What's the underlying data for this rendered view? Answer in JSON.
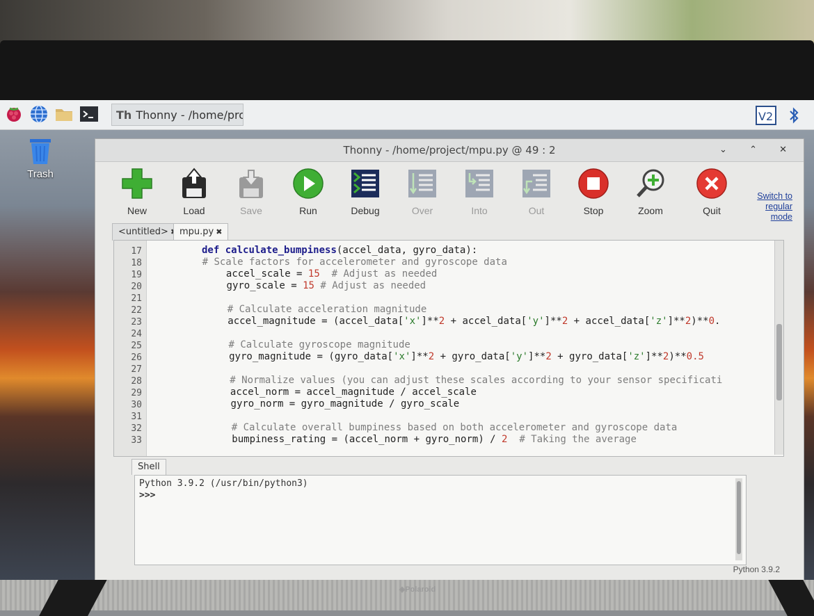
{
  "taskbar": {
    "task_label": "Thonny  -  /home/pro...",
    "right_icons": [
      "vnc-icon",
      "bluetooth-icon"
    ]
  },
  "desktop": {
    "trash_label": "Trash"
  },
  "window": {
    "title": "Thonny  -  /home/project/mpu.py  @  49 : 2",
    "controls": "⌄ ⌃ ✕",
    "switch_mode": [
      "Switch to",
      "regular",
      "mode"
    ]
  },
  "toolbar": [
    {
      "label": "New",
      "icon": "new-icon",
      "enabled": true
    },
    {
      "label": "Load",
      "icon": "load-icon",
      "enabled": true
    },
    {
      "label": "Save",
      "icon": "save-icon",
      "enabled": false
    },
    {
      "label": "Run",
      "icon": "run-icon",
      "enabled": true
    },
    {
      "label": "Debug",
      "icon": "debug-icon",
      "enabled": true
    },
    {
      "label": "Over",
      "icon": "step-over-icon",
      "enabled": false
    },
    {
      "label": "Into",
      "icon": "step-into-icon",
      "enabled": false
    },
    {
      "label": "Out",
      "icon": "step-out-icon",
      "enabled": false
    },
    {
      "label": "Stop",
      "icon": "stop-icon",
      "enabled": true
    },
    {
      "label": "Zoom",
      "icon": "zoom-icon",
      "enabled": true
    },
    {
      "label": "Quit",
      "icon": "quit-icon",
      "enabled": true
    }
  ],
  "tabs": [
    {
      "label": "<untitled>",
      "close": "✖",
      "active": false
    },
    {
      "label": "mpu.py",
      "close": "✖",
      "active": true
    }
  ],
  "editor": {
    "line_numbers": [
      "17",
      "18",
      "19",
      "20",
      "21",
      "22",
      "23",
      "24",
      "25",
      "26",
      "27",
      "28",
      "29",
      "30",
      "31",
      "32",
      "33"
    ],
    "lines": [
      "def calculate_bumpiness(accel_data, gyro_data):",
      "# Scale factors for accelerometer and gyroscope data",
      "    accel_scale = 15  # Adjust as needed",
      "    gyro_scale = 15 # Adjust as needed",
      "",
      "    # Calculate acceleration magnitude",
      "    accel_magnitude = (accel_data['x']**2 + accel_data['y']**2 + accel_data['z']**2)**0.",
      "",
      "    # Calculate gyroscope magnitude",
      "    gyro_magnitude = (gyro_data['x']**2 + gyro_data['y']**2 + gyro_data['z']**2)**0.5",
      "",
      "    # Normalize values (you can adjust these scales according to your sensor specificati",
      "    accel_norm = accel_magnitude / accel_scale",
      "    gyro_norm = gyro_magnitude / gyro_scale",
      "",
      "    # Calculate overall bumpiness based on both accelerometer and gyroscope data",
      "    bumpiness_rating = (accel_norm + gyro_norm) / 2  # Taking the average"
    ]
  },
  "shell": {
    "tab_label": "Shell",
    "banner": "Python 3.9.2 (/usr/bin/python3)",
    "prompt": ">>>"
  },
  "status_bar": {
    "interpreter": "Python 3.9.2"
  },
  "monitor": {
    "brand": "◈Polaroid"
  },
  "colors": {
    "accent_green": "#3fae34",
    "stop_red": "#d9302a",
    "quit_red": "#e43a33",
    "link_blue": "#1f3f9a"
  }
}
